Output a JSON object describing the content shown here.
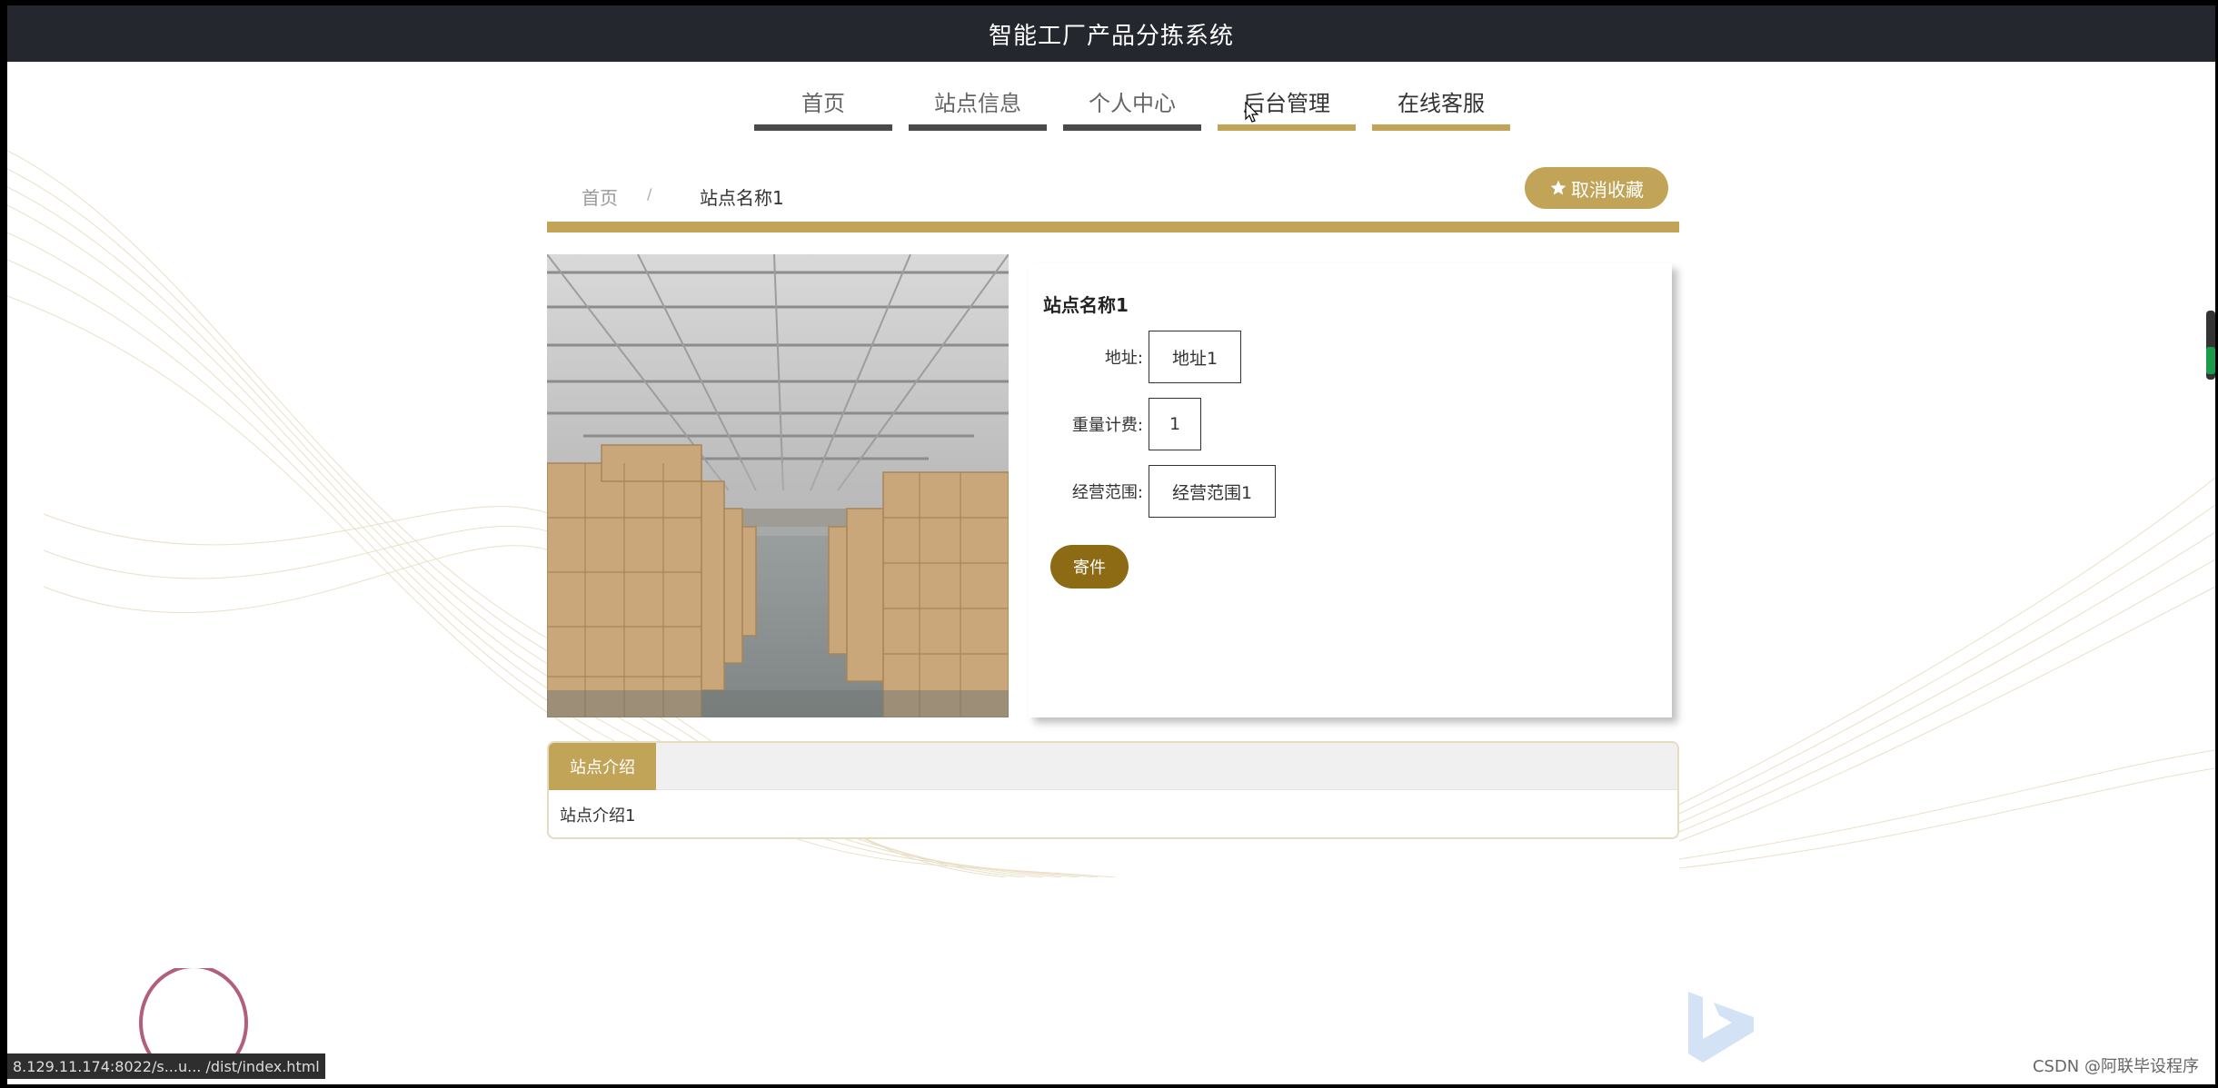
{
  "app": {
    "title": "智能工厂产品分拣系统"
  },
  "nav": [
    {
      "label": "首页"
    },
    {
      "label": "站点信息"
    },
    {
      "label": "个人中心"
    },
    {
      "label": "后台管理"
    },
    {
      "label": "在线客服"
    }
  ],
  "breadcrumb": {
    "home": "首页",
    "separator": "/",
    "current": "站点名称1"
  },
  "favorite_button": {
    "label": "取消收藏"
  },
  "station": {
    "name": "站点名称1",
    "fields": [
      {
        "label": "地址:",
        "value": "地址1"
      },
      {
        "label": "重量计费:",
        "value": "1"
      },
      {
        "label": "经营范围:",
        "value": "经营范围1"
      }
    ],
    "send_label": "寄件"
  },
  "intro": {
    "tab_label": "站点介绍",
    "content": "站点介绍1"
  },
  "status": {
    "url": "8.129.11.174:8022/s...u...    /dist/index.html"
  },
  "watermark": "CSDN @阿联毕设程序",
  "colors": {
    "accent": "#c2a458",
    "dark_button": "#8d6b15",
    "topbar": "#24272e"
  }
}
